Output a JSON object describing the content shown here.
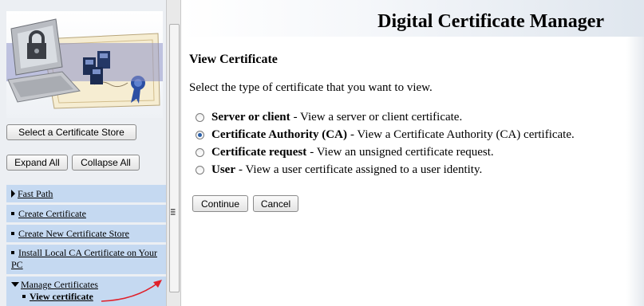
{
  "left_nav": {
    "select_store_button": "Select a Certificate Store",
    "expand_all_button": "Expand All",
    "collapse_all_button": "Collapse All",
    "items": [
      {
        "label": "Fast Path"
      },
      {
        "label": "Create Certificate"
      },
      {
        "label": "Create New Certificate Store"
      },
      {
        "label": "Install Local CA Certificate on Your PC"
      },
      {
        "label": "Manage Certificates"
      }
    ],
    "subitem": {
      "label": "View certificate"
    }
  },
  "main": {
    "app_title": "Digital Certificate Manager",
    "page_heading": "View Certificate",
    "prompt": "Select the type of certificate that you want to view.",
    "options": [
      {
        "label": "Server or client",
        "desc": "- View a server or client certificate.",
        "selected": false
      },
      {
        "label": "Certificate Authority (CA)",
        "desc": "- View a Certificate Authority (CA) certificate.",
        "selected": true
      },
      {
        "label": "Certificate request",
        "desc": "- View an unsigned certificate request.",
        "selected": false
      },
      {
        "label": "User",
        "desc": "- View a user certificate assigned to a user identity.",
        "selected": false
      }
    ],
    "continue_button": "Continue",
    "cancel_button": "Cancel"
  },
  "colors": {
    "nav_item_bg": "#c5d9f1",
    "annotation_arrow": "#e0202a",
    "radio_selected": "#2a5fa8"
  }
}
